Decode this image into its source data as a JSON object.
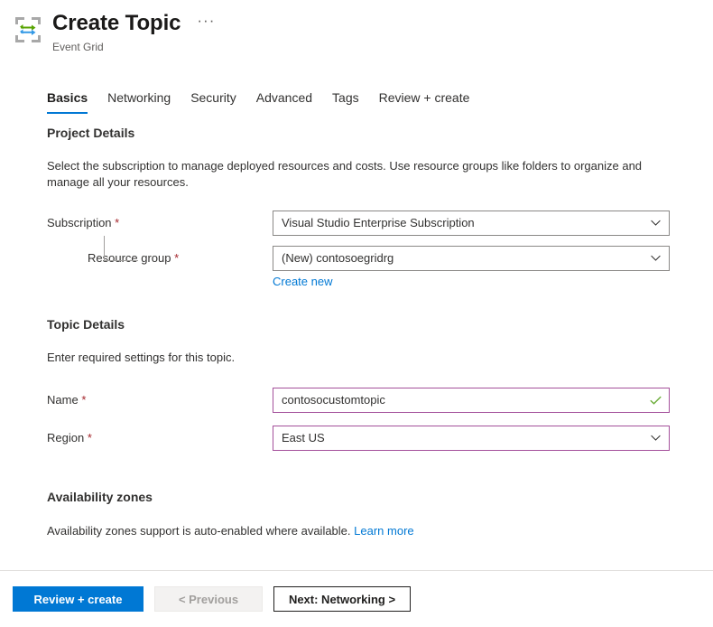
{
  "header": {
    "icon": "event-grid-icon",
    "title": "Create Topic",
    "subtitle": "Event Grid",
    "more_menu": "···"
  },
  "tabs": [
    {
      "label": "Basics",
      "active": true
    },
    {
      "label": "Networking",
      "active": false
    },
    {
      "label": "Security",
      "active": false
    },
    {
      "label": "Advanced",
      "active": false
    },
    {
      "label": "Tags",
      "active": false
    },
    {
      "label": "Review + create",
      "active": false
    }
  ],
  "sections": {
    "project_details": {
      "heading": "Project Details",
      "description": "Select the subscription to manage deployed resources and costs. Use resource groups like folders to organize and manage all your resources.",
      "subscription": {
        "label": "Subscription",
        "required": "*",
        "value": "Visual Studio Enterprise Subscription",
        "control": "dropdown"
      },
      "resource_group": {
        "label": "Resource group",
        "required": "*",
        "value": "(New) contosoegridrg",
        "control": "dropdown",
        "create_new_link": "Create new"
      }
    },
    "topic_details": {
      "heading": "Topic Details",
      "description": "Enter required settings for this topic.",
      "name": {
        "label": "Name",
        "required": "*",
        "value": "contosocustomtopic",
        "control": "textbox",
        "validated": true
      },
      "region": {
        "label": "Region",
        "required": "*",
        "value": "East US",
        "control": "dropdown"
      }
    },
    "availability_zones": {
      "heading": "Availability zones",
      "description": "Availability zones support is auto-enabled where available.",
      "learn_more_link": "Learn more"
    }
  },
  "footer": {
    "review_create_label": "Review + create",
    "previous_label": "< Previous",
    "next_label": "Next: Networking >"
  },
  "colors": {
    "accent_blue": "#0078d4",
    "focus_purple": "#a4509b",
    "required_red": "#a4262c",
    "valid_green": "#498205",
    "border_gray": "#8a8886"
  }
}
